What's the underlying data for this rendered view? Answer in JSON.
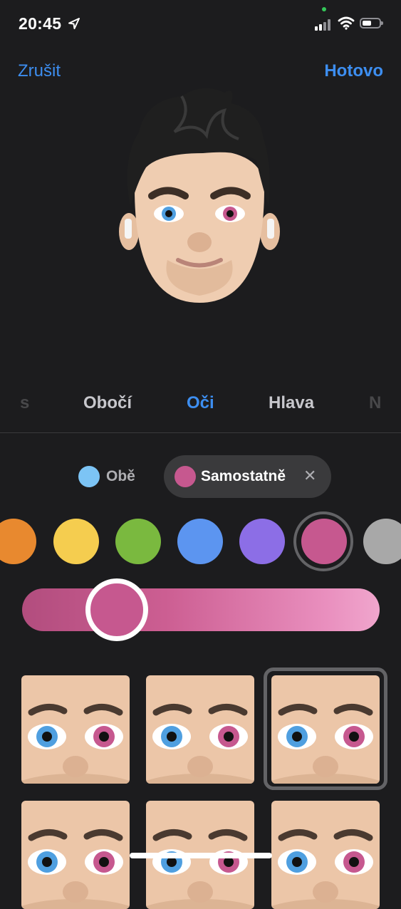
{
  "status_bar": {
    "time": "20:45",
    "icons": [
      "location-arrow-icon",
      "signal-icon",
      "wifi-icon",
      "battery-icon"
    ]
  },
  "nav": {
    "cancel_label": "Zrušit",
    "done_label": "Hotovo"
  },
  "categories": [
    {
      "label": "s",
      "state": "faded"
    },
    {
      "label": "Obočí",
      "state": "normal"
    },
    {
      "label": "Oči",
      "state": "active"
    },
    {
      "label": "Hlava",
      "state": "normal"
    },
    {
      "label": "N",
      "state": "faded"
    }
  ],
  "eye_mode": {
    "both_label": "Obě",
    "separate_label": "Samostatně",
    "both_color": "#7cc4f5",
    "separate_color": "#c6588f",
    "selected": "separate"
  },
  "colors": {
    "swatches": [
      "#e8892f",
      "#f5cd4f",
      "#7ab93f",
      "#5c95f0",
      "#8c6ee6",
      "#c6588f",
      "#a8a8a8"
    ],
    "selected_index": 5,
    "accent": "#3d8ef0"
  },
  "shade_slider": {
    "value": 0.2
  },
  "eye_styles": {
    "selected_index": 2,
    "tiles": [
      {
        "left_iris": "#4f9fe0",
        "right_iris": "#c6588f"
      },
      {
        "left_iris": "#4f9fe0",
        "right_iris": "#c6588f"
      },
      {
        "left_iris": "#4f9fe0",
        "right_iris": "#c6588f"
      },
      {
        "left_iris": "#4f9fe0",
        "right_iris": "#c6588f"
      },
      {
        "left_iris": "#4f9fe0",
        "right_iris": "#c6588f"
      },
      {
        "left_iris": "#4f9fe0",
        "right_iris": "#c6588f"
      }
    ]
  }
}
